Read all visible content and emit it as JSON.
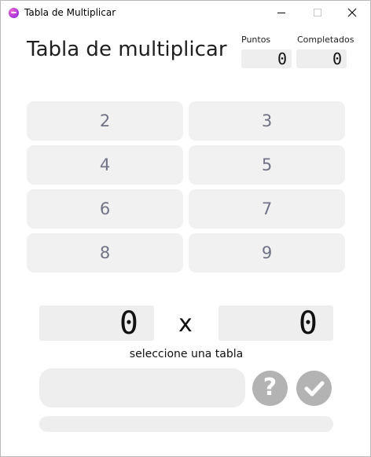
{
  "window": {
    "title": "Tabla de Multiplicar",
    "icon": "app-icon"
  },
  "header": {
    "title": "Tabla de multiplicar",
    "points_label": "Puntos",
    "points_value": "0",
    "completed_label": "Completados",
    "completed_value": "0"
  },
  "tables": [
    "2",
    "3",
    "4",
    "5",
    "6",
    "7",
    "8",
    "9"
  ],
  "problem": {
    "factor_a": "0",
    "operator": "x",
    "factor_b": "0",
    "status": "seleccione una tabla"
  },
  "answer": {
    "value": "",
    "placeholder": ""
  },
  "actions": {
    "help_icon": "question-mark-icon",
    "help_glyph": "?",
    "check_icon": "checkmark-icon"
  },
  "progress": {
    "fraction": 0
  },
  "colors": {
    "button_bg": "#f1f1f1",
    "button_text": "#6f7385",
    "action_circle": "#b3b3b3",
    "field_bg": "#eeeeee"
  }
}
